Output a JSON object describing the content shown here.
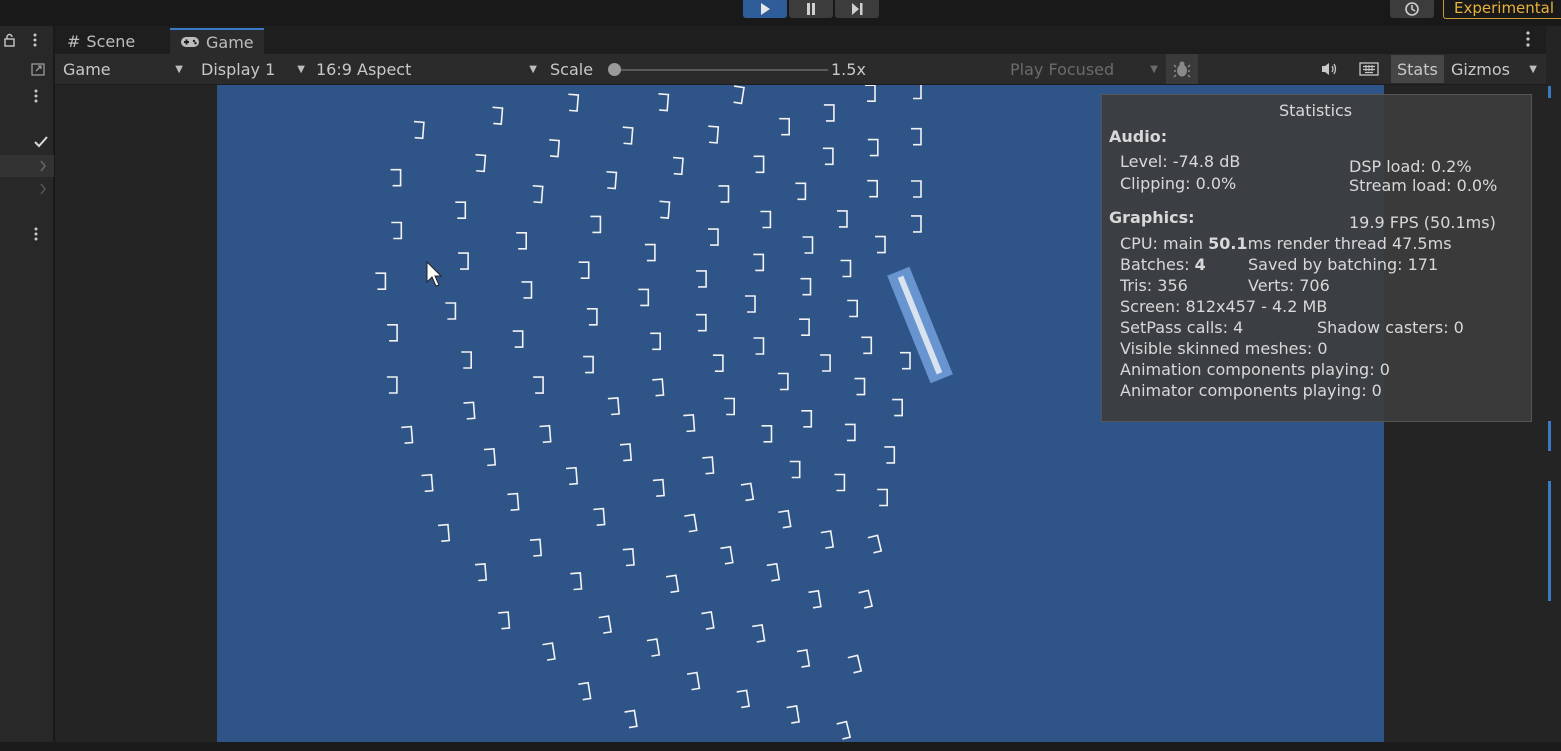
{
  "toolbar": {
    "play_icon": "play-icon",
    "pause_icon": "pause-icon",
    "step_icon": "step-icon",
    "history_icon": "history-icon",
    "experimental_label": "Experimental"
  },
  "tabs": [
    {
      "label": "Scene",
      "icon": "hash-icon"
    },
    {
      "label": "Game",
      "icon": "gamepad-icon",
      "active": true
    }
  ],
  "game_toolbar": {
    "view_select": "Game",
    "display_select": "Display 1",
    "aspect_select": "16:9 Aspect",
    "scale_label": "Scale",
    "scale_value": "1.5x",
    "scale_fraction": 0.0,
    "play_mode_select": "Play Focused",
    "stats_label": "Stats",
    "gizmos_label": "Gizmos"
  },
  "stats": {
    "title": "Statistics",
    "audio_heading": "Audio:",
    "level": "Level: -74.8 dB",
    "clipping": "Clipping: 0.0%",
    "dsp_load": "DSP load: 0.2%",
    "stream_load": "Stream load: 0.0%",
    "graphics_heading": "Graphics:",
    "fps": "19.9 FPS (50.1ms)",
    "cpu_prefix": "CPU: main ",
    "cpu_main": "50.1",
    "cpu_suffix": "ms  render thread 47.5ms",
    "batches_prefix": "Batches: ",
    "batches": "4",
    "saved_by_batching": "Saved by batching: 171",
    "tris": "Tris: 356",
    "verts": "Verts: 706",
    "screen": "Screen: 812x457 - 4.2 MB",
    "setpass": "SetPass calls: 4",
    "shadow_casters": "Shadow casters: 0",
    "skinned": "Visible skinned meshes: 0",
    "animation": "Animation components playing: 0",
    "animator": "Animator components playing: 0"
  },
  "colors": {
    "viewport_bg": "#2f5487",
    "accent": "#3a79c4",
    "experimental": "#e8b23a"
  }
}
